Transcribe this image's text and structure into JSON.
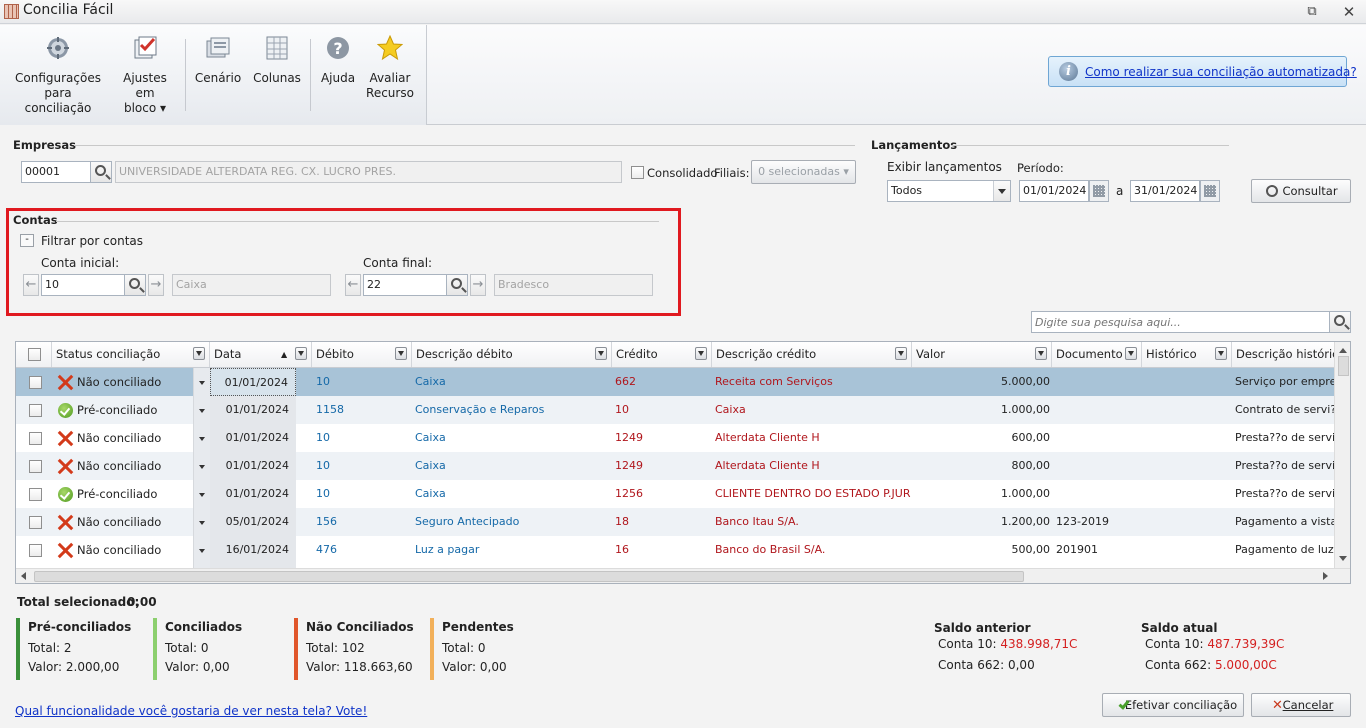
{
  "window": {
    "title": "Concilia Fácil"
  },
  "ribbon": {
    "buttons": [
      {
        "label1": "Configurações",
        "label2": "para conciliação"
      },
      {
        "label1": "Ajustes em",
        "label2": "bloco ▾"
      },
      {
        "label1": "Cenário",
        "label2": ""
      },
      {
        "label1": "Colunas",
        "label2": ""
      },
      {
        "label1": "Ajuda",
        "label2": ""
      },
      {
        "label1": "Avaliar",
        "label2": "Recurso"
      }
    ],
    "help_link": "Como realizar sua conciliação automatizada?"
  },
  "empresas": {
    "heading": "Empresas",
    "code": "00001",
    "name": "UNIVERSIDADE ALTERDATA REG. CX. LUCRO PRES.",
    "consolidado_label": "Consolidado",
    "filiais_label": "Filiais:",
    "filiais_value": "0 selecionadas"
  },
  "lancamentos": {
    "heading": "Lançamentos",
    "exibir_label": "Exibir lançamentos",
    "exibir_value": "Todos",
    "periodo_label": "Período:",
    "date_from": "01/01/2024",
    "a_label": "a",
    "date_to": "31/01/2024",
    "consultar_label": "Consultar"
  },
  "contas": {
    "heading": "Contas",
    "toggle": "-",
    "filter_label": "Filtrar por contas",
    "inicial_label": "Conta inicial:",
    "inicial_code": "10",
    "inicial_name": "Caixa",
    "final_label": "Conta final:",
    "final_code": "22",
    "final_name": "Bradesco"
  },
  "search": {
    "placeholder": "Digite sua pesquisa aqui..."
  },
  "grid": {
    "columns": [
      "Status conciliação",
      "Data",
      "Débito",
      "Descrição débito",
      "Crédito",
      "Descrição crédito",
      "Valor",
      "Documento",
      "Histórico",
      "Descrição histórico"
    ],
    "sort_indicator": "▲",
    "rows": [
      {
        "status": "Não conciliado",
        "status_type": "x",
        "data": "01/01/2024",
        "debito": "10",
        "desc_debito": "Caixa",
        "credito": "662",
        "desc_credito": "Receita com Serviços",
        "valor": "5.000,00",
        "documento": "",
        "historico": "",
        "desc_historico": "Serviço por empreitada"
      },
      {
        "status": "Pré-conciliado",
        "status_type": "ok",
        "data": "01/01/2024",
        "debito": "1158",
        "desc_debito": "Conservação e Reparos",
        "credito": "10",
        "desc_credito": "Caixa",
        "valor": "1.000,00",
        "documento": "",
        "historico": "",
        "desc_historico": "Contrato de servi?os"
      },
      {
        "status": "Não conciliado",
        "status_type": "x",
        "data": "01/01/2024",
        "debito": "10",
        "desc_debito": "Caixa",
        "credito": "1249",
        "desc_credito": "Alterdata Cliente H",
        "valor": "600,00",
        "documento": "",
        "historico": "",
        "desc_historico": "Presta??o de servi?os"
      },
      {
        "status": "Não conciliado",
        "status_type": "x",
        "data": "01/01/2024",
        "debito": "10",
        "desc_debito": "Caixa",
        "credito": "1249",
        "desc_credito": "Alterdata Cliente H",
        "valor": "800,00",
        "documento": "",
        "historico": "",
        "desc_historico": "Presta??o de servi?os"
      },
      {
        "status": "Pré-conciliado",
        "status_type": "ok",
        "data": "01/01/2024",
        "debito": "10",
        "desc_debito": "Caixa",
        "credito": "1256",
        "desc_credito": "CLIENTE DENTRO DO ESTADO P.JURÍDICA",
        "valor": "1.000,00",
        "documento": "",
        "historico": "",
        "desc_historico": "Presta??o de servi?os"
      },
      {
        "status": "Não conciliado",
        "status_type": "x",
        "data": "05/01/2024",
        "debito": "156",
        "desc_debito": "Seguro Antecipado",
        "credito": "18",
        "desc_credito": "Banco Itau S/A.",
        "valor": "1.200,00",
        "documento": "123-2019",
        "historico": "",
        "desc_historico": "Pagamento a vista de"
      },
      {
        "status": "Não conciliado",
        "status_type": "x",
        "data": "16/01/2024",
        "debito": "476",
        "desc_debito": "Luz a pagar",
        "credito": "16",
        "desc_credito": "Banco do Brasil S/A.",
        "valor": "500,00",
        "documento": "201901",
        "historico": "",
        "desc_historico": "Pagamento de luz e"
      }
    ]
  },
  "totals": {
    "label": "Total selecionado:",
    "value": "0,00"
  },
  "summary": [
    {
      "title": "Pré-conciliados",
      "total": "Total: 2",
      "valor": "Valor: 2.000,00",
      "color": "#3a8f3a"
    },
    {
      "title": "Conciliados",
      "total": "Total: 0",
      "valor": "Valor: 0,00",
      "color": "#8ccf6e"
    },
    {
      "title": "Não Conciliados",
      "total": "Total: 102",
      "valor": "Valor: 118.663,60",
      "color": "#e0562a"
    },
    {
      "title": "Pendentes",
      "total": "Total: 0",
      "valor": "Valor: 0,00",
      "color": "#f2b05a"
    }
  ],
  "saldo_anterior": {
    "title": "Saldo anterior",
    "l1_label": "Conta 10:",
    "l1_value": "438.998,71C",
    "l2_label": "Conta 662:",
    "l2_value": "0,00"
  },
  "saldo_atual": {
    "title": "Saldo atual",
    "l1_label": "Conta 10:",
    "l1_value": "487.739,39C",
    "l2_label": "Conta 662:",
    "l2_value": "5.000,00C"
  },
  "footer": {
    "vote_link": "Qual funcionalidade você gostaria de ver nesta tela? Vote!",
    "efetivar_label": "Efetivar conciliação",
    "cancelar_label": "Cancelar"
  }
}
